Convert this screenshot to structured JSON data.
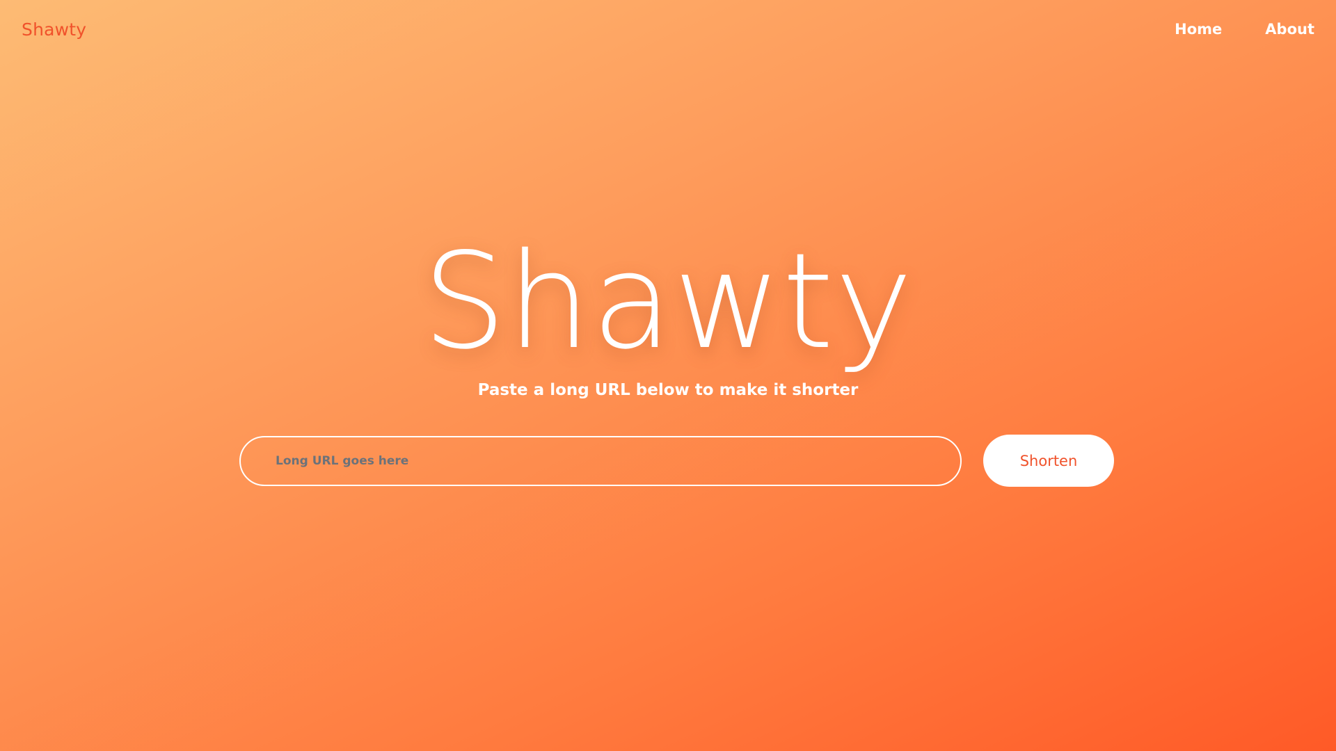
{
  "header": {
    "brand": "Shawty",
    "nav": [
      {
        "label": "Home"
      },
      {
        "label": "About"
      }
    ]
  },
  "hero": {
    "title": "Shawty",
    "subtitle": "Paste a long URL below to make it shorter"
  },
  "form": {
    "url_placeholder": "Long URL goes here",
    "url_value": "",
    "submit_label": "Shorten"
  },
  "colors": {
    "accent": "#f0522b",
    "gradient_start": "#fdbb74",
    "gradient_end": "#ff5a27",
    "text_light": "#ffffff"
  }
}
